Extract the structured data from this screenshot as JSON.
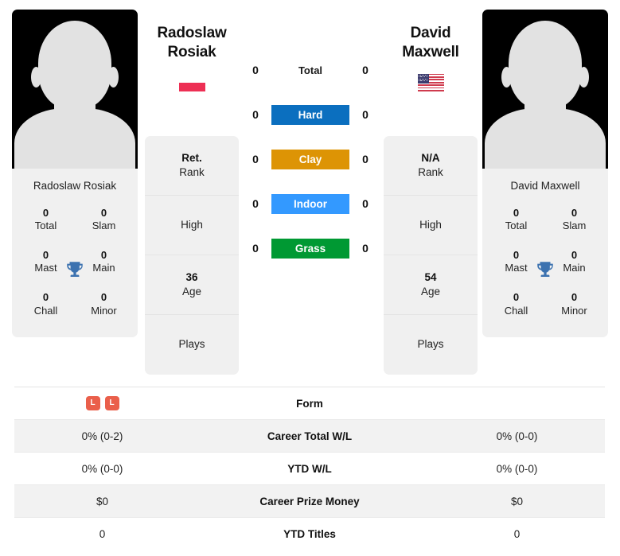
{
  "players": {
    "left": {
      "first_name": "Radoslaw",
      "last_name": "Rosiak",
      "full_name": "Radoslaw Rosiak",
      "flag": "poland-flag",
      "titles": [
        {
          "value": "0",
          "label": "Total"
        },
        {
          "value": "0",
          "label": "Slam"
        },
        {
          "value": "0",
          "label": "Mast"
        },
        {
          "value": "0",
          "label": "Main"
        },
        {
          "value": "0",
          "label": "Chall"
        },
        {
          "value": "0",
          "label": "Minor"
        }
      ],
      "stats": [
        {
          "value": "Ret.",
          "label": "Rank"
        },
        {
          "value": "",
          "label": "High"
        },
        {
          "value": "36",
          "label": "Age"
        },
        {
          "value": "",
          "label": "Plays"
        }
      ]
    },
    "right": {
      "first_name": "David",
      "last_name": "Maxwell",
      "full_name": "David Maxwell",
      "flag": "usa-flag",
      "titles": [
        {
          "value": "0",
          "label": "Total"
        },
        {
          "value": "0",
          "label": "Slam"
        },
        {
          "value": "0",
          "label": "Mast"
        },
        {
          "value": "0",
          "label": "Main"
        },
        {
          "value": "0",
          "label": "Chall"
        },
        {
          "value": "0",
          "label": "Minor"
        }
      ],
      "stats": [
        {
          "value": "N/A",
          "label": "Rank"
        },
        {
          "value": "",
          "label": "High"
        },
        {
          "value": "54",
          "label": "Age"
        },
        {
          "value": "",
          "label": "Plays"
        }
      ]
    }
  },
  "surfaces": [
    {
      "label": "Total",
      "left": "0",
      "right": "0",
      "color": "transparent",
      "plain": true
    },
    {
      "label": "Hard",
      "left": "0",
      "right": "0",
      "color": "#0b6fbf",
      "plain": false
    },
    {
      "label": "Clay",
      "left": "0",
      "right": "0",
      "color": "#dd9405",
      "plain": false
    },
    {
      "label": "Indoor",
      "left": "0",
      "right": "0",
      "color": "#3399ff",
      "plain": false
    },
    {
      "label": "Grass",
      "left": "0",
      "right": "0",
      "color": "#009933",
      "plain": false
    }
  ],
  "comparison_rows": [
    {
      "label": "Form",
      "left": "",
      "right": "",
      "left_form": [
        "L",
        "L"
      ],
      "right_form": []
    },
    {
      "label": "Career Total W/L",
      "left": "0% (0-2)",
      "right": "0% (0-0)",
      "left_form": [],
      "right_form": []
    },
    {
      "label": "YTD W/L",
      "left": "0% (0-0)",
      "right": "0% (0-0)",
      "left_form": [],
      "right_form": []
    },
    {
      "label": "Career Prize Money",
      "left": "$0",
      "right": "$0",
      "left_form": [],
      "right_form": []
    },
    {
      "label": "YTD Titles",
      "left": "0",
      "right": "0",
      "left_form": [],
      "right_form": []
    }
  ],
  "colors": {
    "hard": "#0b6fbf",
    "clay": "#dd9405",
    "indoor": "#3399ff",
    "grass": "#009933",
    "loss_badge": "#ea5f4b",
    "trophy": "#3c72b0",
    "card_bg": "#f0f0f0",
    "row_shade": "#f2f2f2"
  }
}
